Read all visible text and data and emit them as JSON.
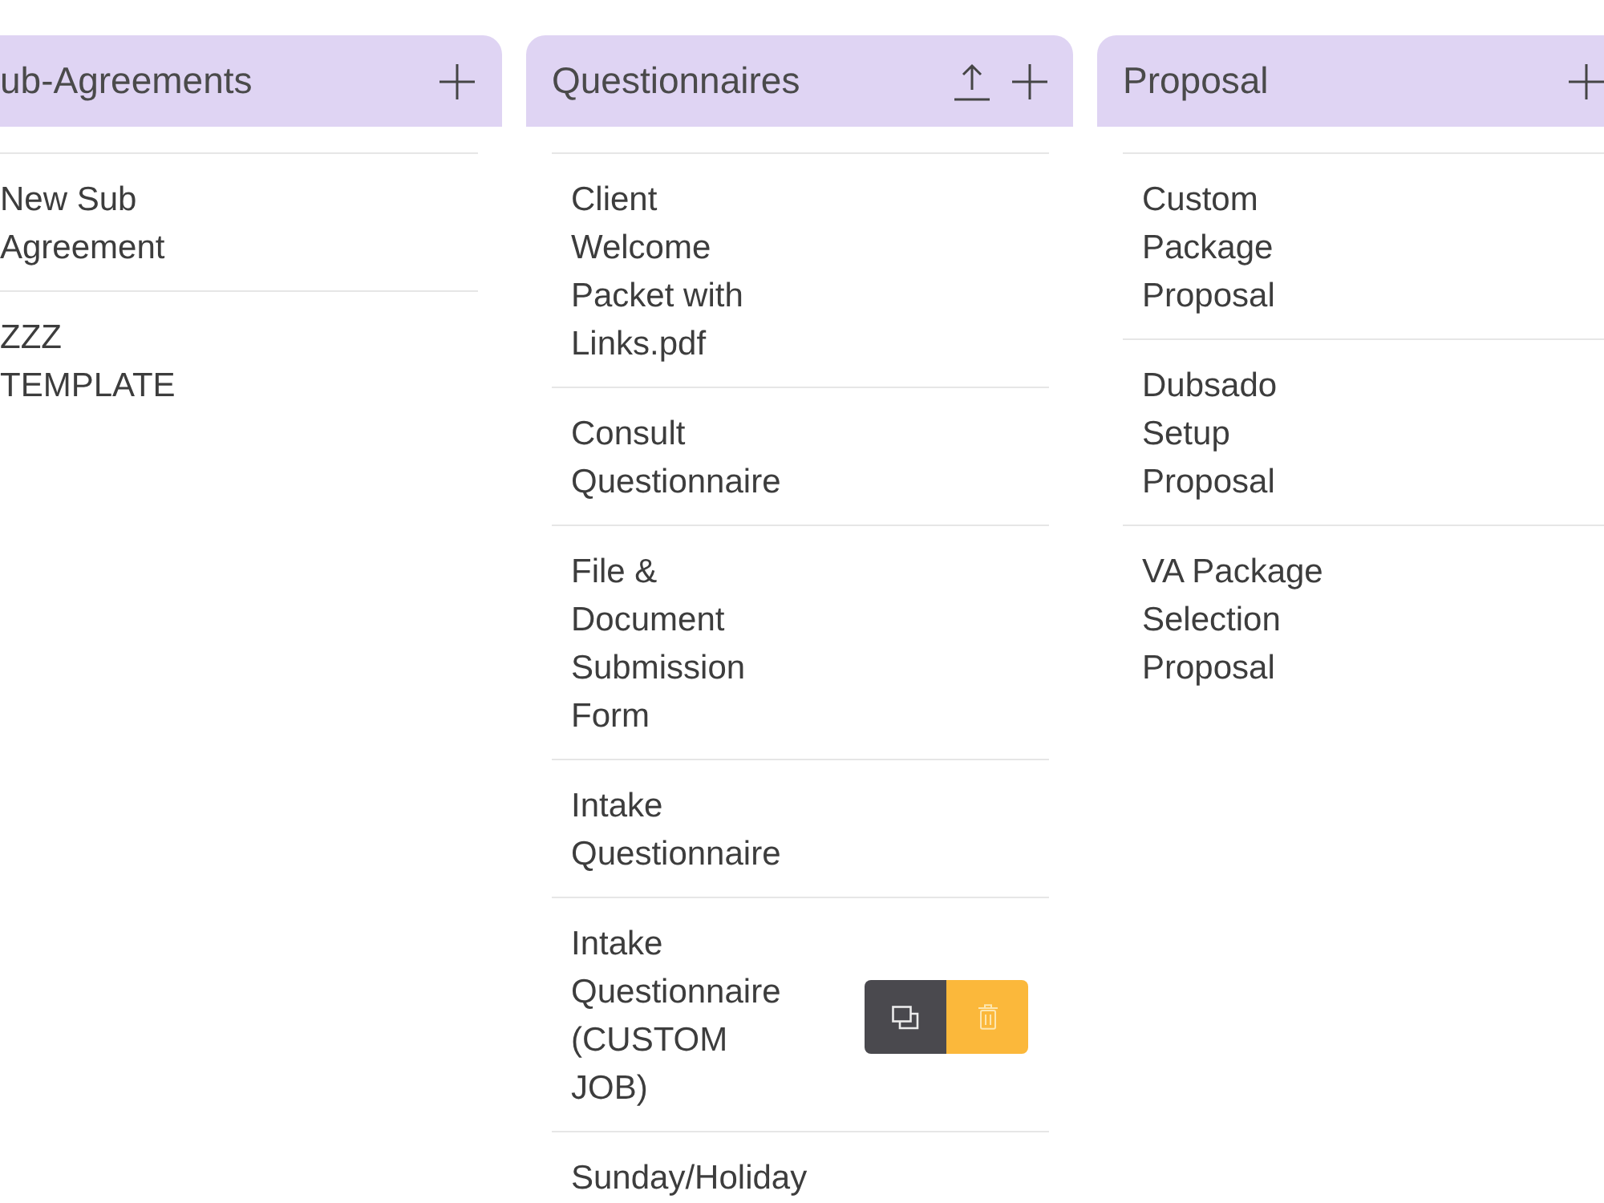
{
  "columns": [
    {
      "title": "ub-Agreements",
      "can_upload": false,
      "items": [
        {
          "title": "New Sub Agreement",
          "hovered": false
        },
        {
          "title": "ZZZ TEMPLATE",
          "hovered": false
        }
      ]
    },
    {
      "title": "Questionnaires",
      "can_upload": true,
      "items": [
        {
          "title": "Client Welcome Packet with Links.pdf",
          "hovered": false
        },
        {
          "title": "Consult Questionnaire",
          "hovered": false
        },
        {
          "title": "File & Document Submission Form",
          "hovered": false
        },
        {
          "title": "Intake Questionnaire",
          "hovered": false
        },
        {
          "title": "Intake Questionnaire (CUSTOM JOB)",
          "hovered": true
        },
        {
          "title": "Sunday/Holiday",
          "hovered": false
        }
      ]
    },
    {
      "title": "Proposal",
      "can_upload": false,
      "items": [
        {
          "title": "Custom Package Proposal",
          "hovered": false
        },
        {
          "title": "Dubsado Setup Proposal",
          "hovered": false
        },
        {
          "title": "VA Package Selection Proposal",
          "hovered": false
        }
      ]
    }
  ]
}
